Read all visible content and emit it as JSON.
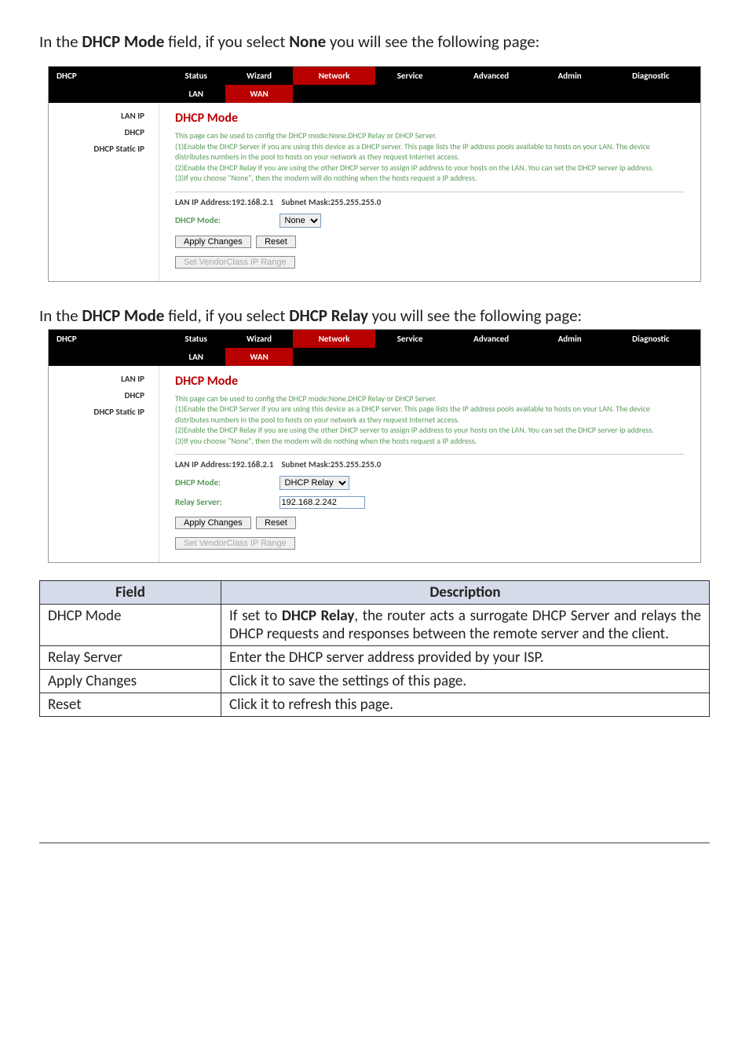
{
  "intro1": {
    "pre": "In the ",
    "b1": "DHCP Mode",
    "mid": " field, if you select ",
    "b2": "None",
    "post": " you will see the following page:"
  },
  "intro2": {
    "pre": "In the ",
    "b1": "DHCP Mode",
    "mid": " field, if you select ",
    "b2": "DHCP Relay",
    "post": " you will see the following page:"
  },
  "router": {
    "sidebar": {
      "dhcp": "DHCP",
      "lan": "LAN",
      "wan": "WAN"
    },
    "tabs": {
      "status": "Status",
      "wizard": "Wizard",
      "network": "Network",
      "service": "Service",
      "advanced": "Advanced",
      "admin": "Admin",
      "diagnostic": "Diagnostic"
    },
    "side_items": {
      "lanip": "LAN IP",
      "dhcp": "DHCP",
      "dhcp_static": "DHCP Static IP"
    },
    "heading": "DHCP Mode",
    "desc_line1": "This page can be used to config the DHCP mode:None,DHCP Relay or DHCP Server.",
    "desc_line2": "(1)Enable the DHCP Server if you are using this device as a DHCP server. This page lists the IP address pools available to hosts on your LAN. The device distributes numbers in the pool to hosts on your network as they request Internet access.",
    "desc_line3": "(2)Enable the DHCP Relay if you are using the other DHCP server to assign IP address to your hosts on the LAN. You can set the DHCP server ip address.",
    "desc_line4": "(3)If you choose \"None\", then the modem will do nothing when the hosts request a IP address.",
    "ip_line_label_ip": "LAN IP Address:",
    "ip_val": "192.168.2.1",
    "ip_line_label_mask": "Subnet Mask:",
    "mask_val": "255.255.255.0",
    "mode_label": "DHCP Mode:",
    "relay_label": "Relay Server:",
    "relay_val": "192.168.2.242",
    "mode_options": {
      "none": "None",
      "relay": "DHCP Relay"
    },
    "btn_apply": "Apply Changes",
    "btn_reset": "Reset",
    "btn_vendor": "Set VendorClass IP Range"
  },
  "field_table": {
    "headers": {
      "field": "Field",
      "desc": "Description"
    },
    "rows": {
      "mode": {
        "field": "DHCP Mode",
        "d_pre": "If set to ",
        "d_b": "DHCP Relay",
        "d_post": ", the router acts a surrogate DHCP Server and relays the DHCP requests and responses between the remote server and the client."
      },
      "relay": {
        "field": "Relay Server",
        "desc": "Enter the DHCP server address provided by your ISP."
      },
      "apply": {
        "field": "Apply Changes",
        "desc": "Click it to save the settings of this page."
      },
      "reset": {
        "field": "Reset",
        "desc": "Click it to refresh this page."
      }
    }
  }
}
